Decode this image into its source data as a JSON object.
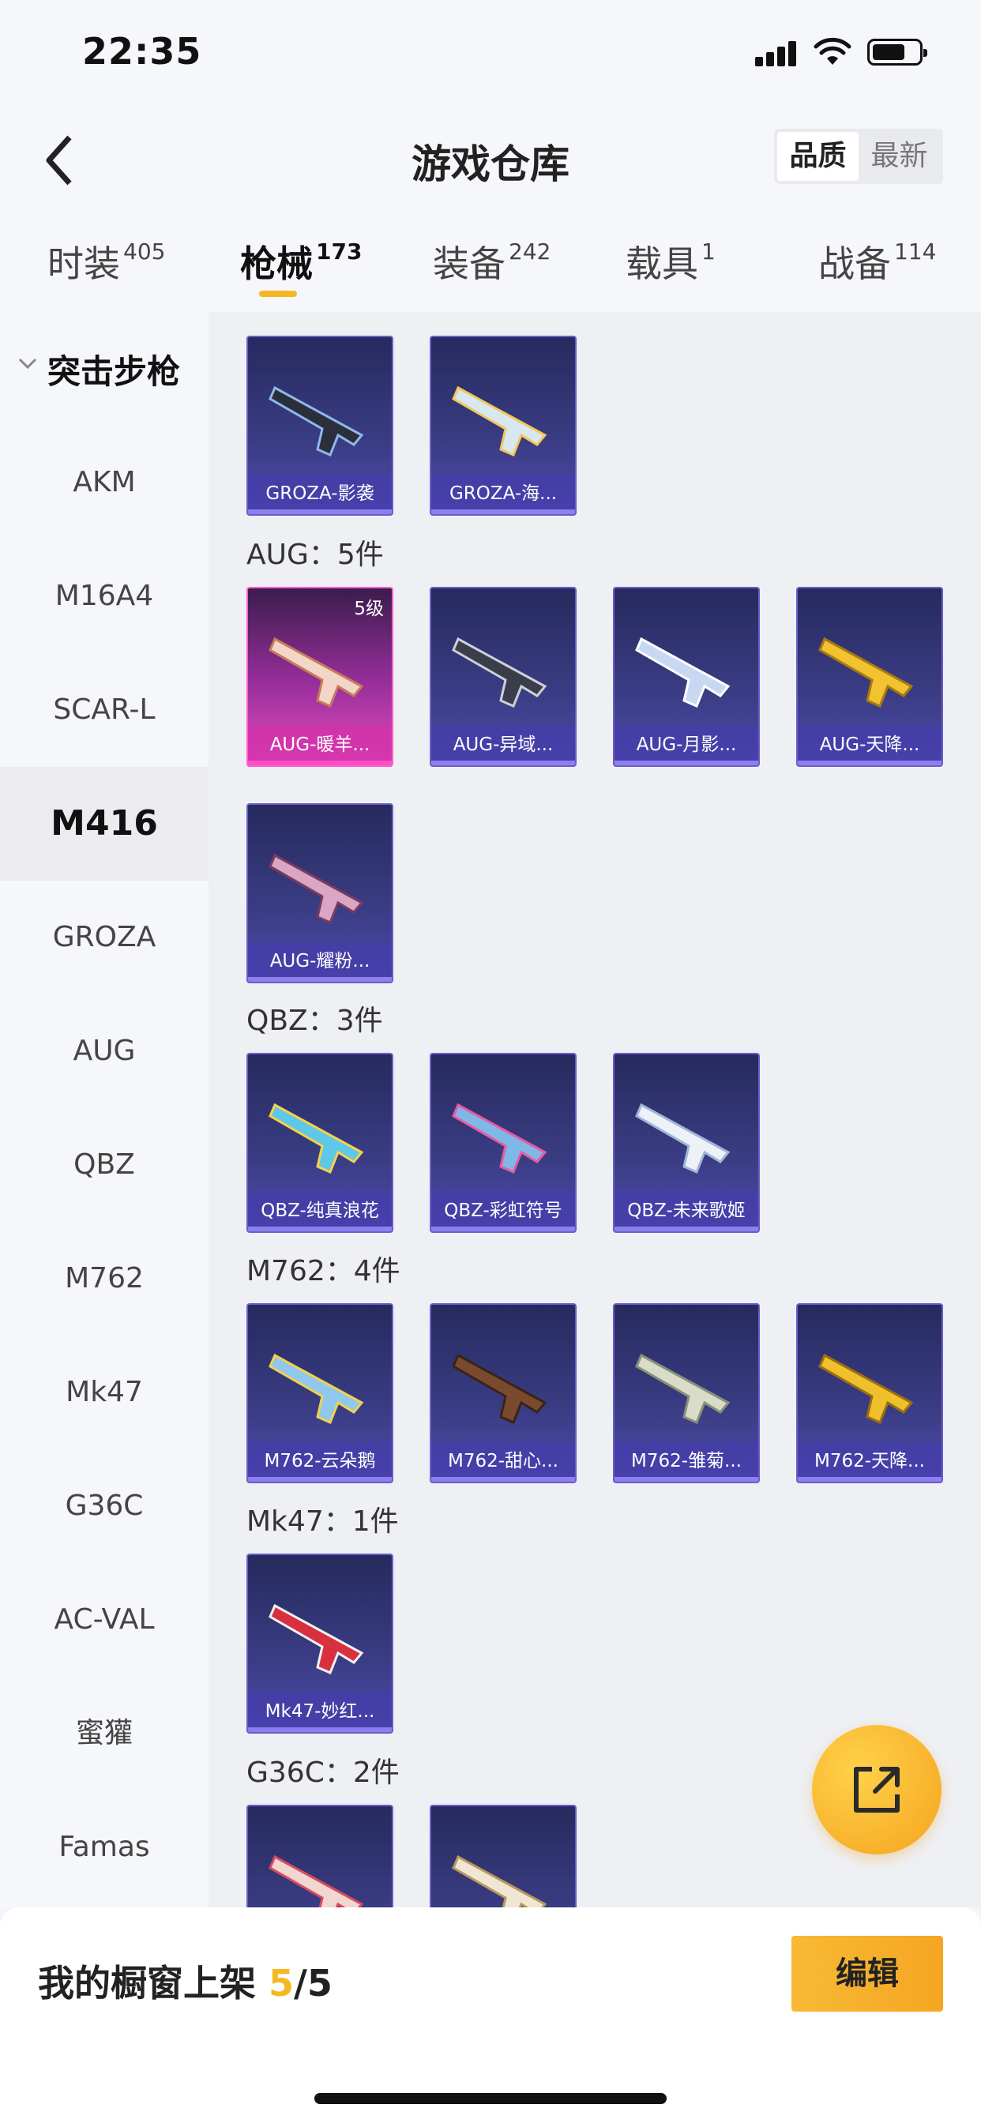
{
  "status": {
    "time": "22:35"
  },
  "header": {
    "title": "游戏仓库",
    "sort_active": "品质",
    "sort_inactive": "最新"
  },
  "tabs": [
    {
      "label": "时装",
      "count": "405"
    },
    {
      "label": "枪械",
      "count": "173"
    },
    {
      "label": "装备",
      "count": "242"
    },
    {
      "label": "载具",
      "count": "1"
    },
    {
      "label": "战备",
      "count": "114"
    }
  ],
  "sidebar": {
    "header": "突击步枪",
    "items": [
      "AKM",
      "M16A4",
      "SCAR-L",
      "M416",
      "GROZA",
      "AUG",
      "QBZ",
      "M762",
      "Mk47",
      "G36C",
      "AC-VAL",
      "蜜獾",
      "Famas"
    ],
    "selected": "M416"
  },
  "groups": {
    "groza": {
      "cards": [
        "GROZA-影袭",
        "GROZA-海..."
      ]
    },
    "aug": {
      "label": "AUG：5件",
      "cards": [
        "AUG-暖羊...",
        "AUG-异域...",
        "AUG-月影...",
        "AUG-天降...",
        "AUG-耀粉..."
      ],
      "level": "5级"
    },
    "qbz": {
      "label": "QBZ：3件",
      "cards": [
        "QBZ-纯真浪花",
        "QBZ-彩虹符号",
        "QBZ-未来歌姬"
      ]
    },
    "m762": {
      "label": "M762：4件",
      "cards": [
        "M762-云朵鹅",
        "M762-甜心...",
        "M762-雏菊...",
        "M762-天降..."
      ]
    },
    "mk47": {
      "label": "Mk47：1件",
      "cards": [
        "Mk47-妙红..."
      ]
    },
    "g36c": {
      "label": "G36C：2件"
    }
  },
  "bottom": {
    "window_label": "我的橱窗上架",
    "count": "5",
    "total": "/5",
    "edit": "编辑"
  },
  "colors": {
    "accent": "#f5b823",
    "card_blue": "#3a3d84",
    "card_pink": "#e64eb7"
  }
}
